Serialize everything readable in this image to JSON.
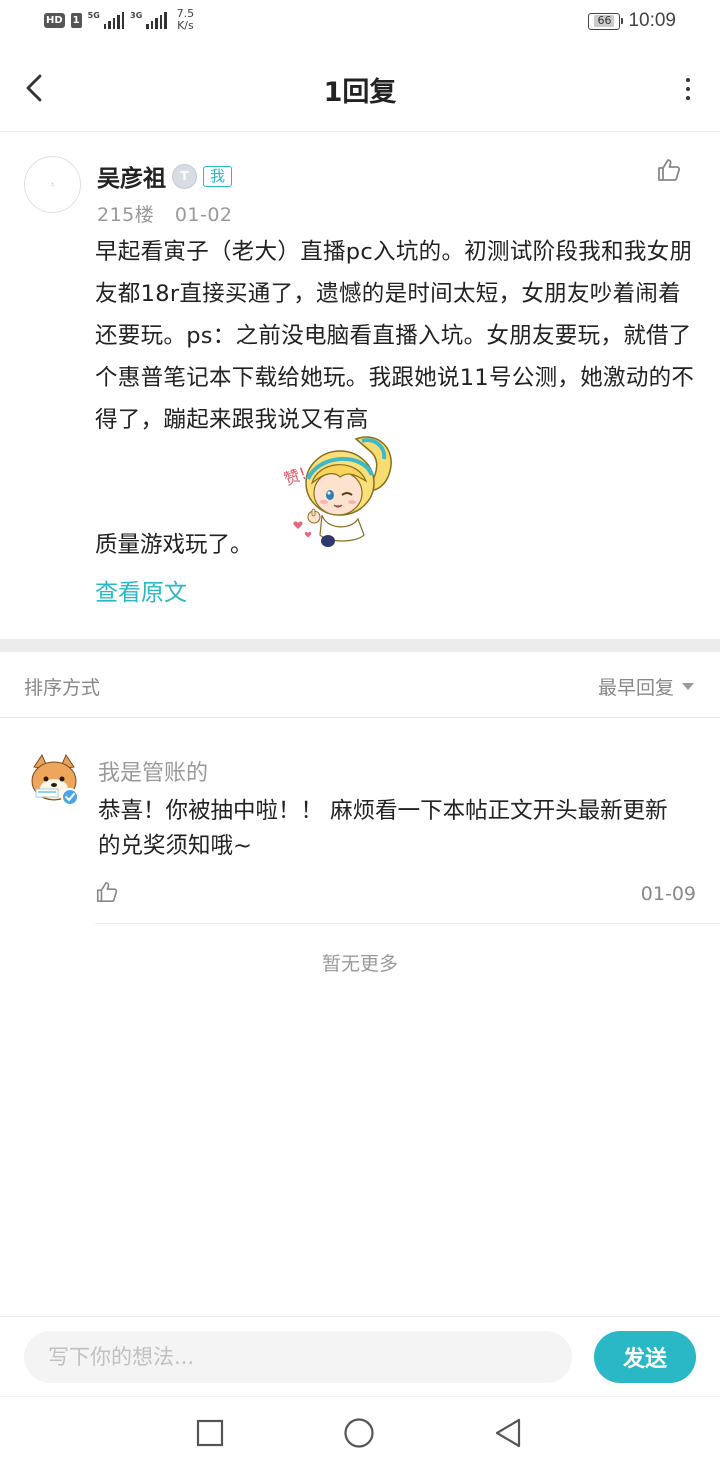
{
  "status_bar": {
    "hd": "HD",
    "sim": "1",
    "net1": "5G",
    "net2": "3G",
    "speed_value": "7.5",
    "speed_unit": "K/s",
    "battery": "66",
    "time": "10:09"
  },
  "header": {
    "title": "1回复"
  },
  "post": {
    "author": "吴彦祖",
    "level_badge": "T",
    "me_badge": "我",
    "floor": "215楼",
    "date": "01-02",
    "text": "早起看寅子（老大）直播pc入坑的。初测试阶段我和我女朋友都18r直接买通了，遗憾的是时间太短，女朋友吵着闹着还要玩。ps：之前没电脑看直播入坑。女朋友要玩，就借了个惠普笔记本下载给她玩。我跟她说11号公测，她激动的不得了，蹦起来跟我说又有高",
    "text_last": "质量游戏玩了。",
    "sticker_text": "赞!",
    "view_original": "查看原文"
  },
  "sort": {
    "label": "排序方式",
    "selected": "最早回复"
  },
  "reply": {
    "author": "我是管账的",
    "text": "恭喜！你被抽中啦！！ 麻烦看一下本帖正文开头最新更新的兑奖须知哦~",
    "date": "01-09"
  },
  "no_more": "暂无更多",
  "input_bar": {
    "placeholder": "写下你的想法...",
    "send": "发送"
  },
  "colors": {
    "accent": "#2ab8c7",
    "divider": "#ececec"
  }
}
